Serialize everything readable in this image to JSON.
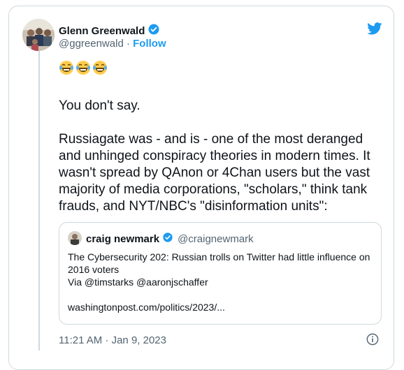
{
  "tweet": {
    "author_name": "Glenn Greenwald",
    "author_handle": "@ggreenwald",
    "separator": "·",
    "follow_label": "Follow",
    "emojis": [
      "😂",
      "😂",
      "😂"
    ],
    "paragraphs": [
      "You don't say.",
      "Russiagate was - and is - one of the most deranged and unhinged conspiracy theories in modern times. It wasn't spread by QAnon or 4Chan users but the vast majority of media corporations, \"scholars,\" think tank frauds, and NYT/NBC's \"disinformation units\":"
    ],
    "timestamp": "11:21 AM · Jan 9, 2023",
    "verified": true
  },
  "quoted_tweet": {
    "author_name": "craig newmark",
    "author_handle": "@craignewmark",
    "verified": true,
    "text": "The Cybersecurity 202: Russian trolls on Twitter had little influence on 2016 voters\nVia @timstarks @aaronjschaffer",
    "link": "washingtonpost.com/politics/2023/..."
  },
  "colors": {
    "accent": "#1d9bf0",
    "secondary_text": "#536471",
    "border": "#cfd9de"
  },
  "icons": [
    "twitter-bird-icon",
    "verified-badge-icon",
    "info-icon"
  ]
}
